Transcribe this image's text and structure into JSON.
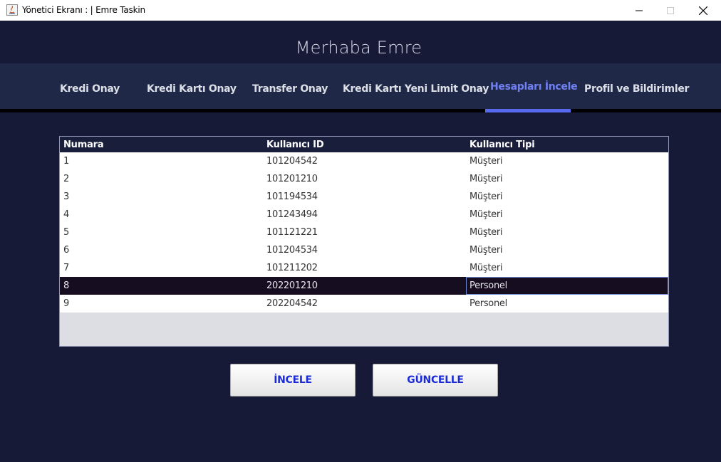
{
  "window": {
    "title": "Yönetici Ekranı : | Emre Taskin"
  },
  "header": {
    "greeting": "Merhaba Emre"
  },
  "tabs": [
    {
      "label": "Kredi Onay",
      "active": false
    },
    {
      "label": "Kredi Kartı Onay",
      "active": false
    },
    {
      "label": "Transfer Onay",
      "active": false
    },
    {
      "label": "Kredi Kartı Yeni Limit Onay",
      "active": false
    },
    {
      "label": "Hesapları İncele",
      "active": true
    },
    {
      "label": "Profil ve Bildirimler",
      "active": false
    }
  ],
  "table": {
    "columns": [
      "Numara",
      "Kullanıcı ID",
      "Kullanıcı Tipi"
    ],
    "rows": [
      [
        "1",
        "101204542",
        "Müşteri"
      ],
      [
        "2",
        "101201210",
        "Müşteri"
      ],
      [
        "3",
        "101194534",
        "Müşteri"
      ],
      [
        "4",
        "101243494",
        "Müşteri"
      ],
      [
        "5",
        "101121221",
        "Müşteri"
      ],
      [
        "6",
        "101204534",
        "Müşteri"
      ],
      [
        "7",
        "101211202",
        "Müşteri"
      ],
      [
        "8",
        "202201210",
        "Personel"
      ],
      [
        "9",
        "202204542",
        "Personel"
      ]
    ],
    "selected_row": "8"
  },
  "actions": {
    "incele_label": "İNCELE",
    "guncelle_label": "GÜNCELLE"
  },
  "colors": {
    "background": "#171a36",
    "tabbar": "#202848",
    "accent": "#5769ec",
    "button_text": "#1b2bd6"
  }
}
